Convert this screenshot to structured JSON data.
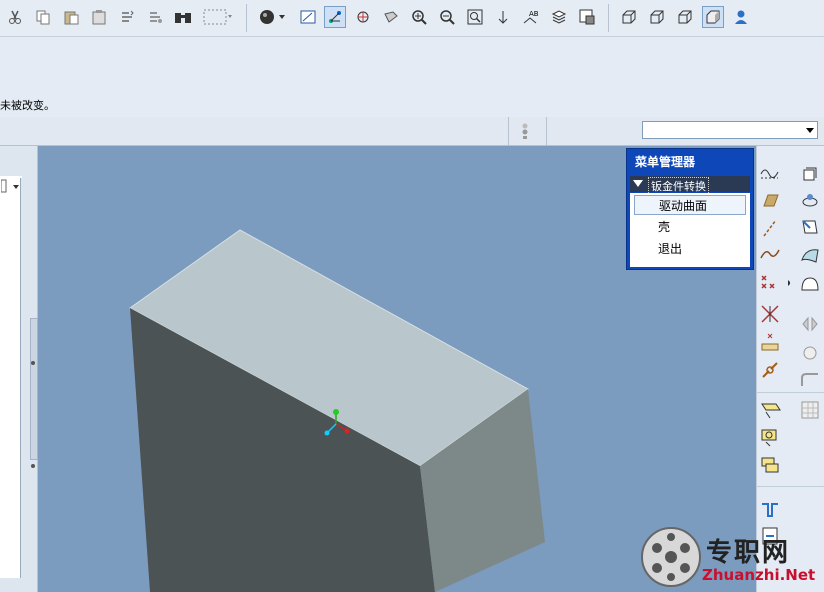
{
  "toolbar": {
    "icons": [
      "cut-icon",
      "copy-icon",
      "paste-icon",
      "paste-special-icon",
      "regenerate-icon",
      "regen-manager-icon",
      "find-icon",
      "select-box-icon",
      "appearance-sphere-icon",
      "saved-view-icon",
      "datum-display-icon",
      "csys-display-icon",
      "refit-icon",
      "zoom-in-icon",
      "zoom-out-icon",
      "zoom-fit-icon",
      "spin-center-icon",
      "layers-icon",
      "model-tree-icon",
      "wireframe-icon",
      "hidden-line-icon",
      "no-hidden-icon",
      "shaded-icon",
      "user-icon"
    ]
  },
  "message": {
    "text": "未被改变。"
  },
  "status": {
    "dropdown_value": ""
  },
  "menu_manager": {
    "title": "菜单管理器",
    "section": "钣金件转换",
    "items": [
      "驱动曲面",
      "壳",
      "退出"
    ]
  },
  "watermark": {
    "line1": "专职网",
    "line2": "Zhuanzhi.Net"
  },
  "colors": {
    "viewport": "#7b9bbf",
    "menu_blue": "#0d47b8",
    "box_top": "#b9c6cc",
    "box_front": "#4b5354",
    "box_side": "#7d8989",
    "watermark_red": "#c8102e"
  }
}
